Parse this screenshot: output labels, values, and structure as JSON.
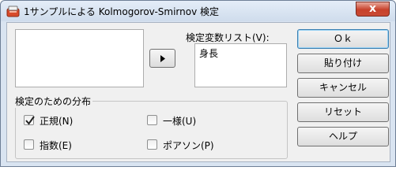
{
  "window": {
    "title": "1サンプルによる Kolmogorov-Smirnov 検定",
    "close_glyph": "x"
  },
  "source_list": {
    "items": []
  },
  "move_button": {
    "icon": "triangle-right-icon"
  },
  "test_variables": {
    "label": "検定変数リスト(V):",
    "items": [
      "身長"
    ]
  },
  "distribution_group": {
    "label": "検定のための分布",
    "options": {
      "normal": {
        "label": "正規(N)",
        "checked": true
      },
      "uniform": {
        "label": "一様(U)",
        "checked": false
      },
      "exponential": {
        "label": "指数(E)",
        "checked": false
      },
      "poisson": {
        "label": "ポアソン(P)",
        "checked": false
      }
    }
  },
  "buttons": {
    "ok": "Ｏｋ",
    "paste": "貼り付け",
    "cancel": "キャンセル",
    "reset": "リセット",
    "help": "ヘルプ"
  },
  "colors": {
    "titlebar": "#d9e4f1",
    "close_button": "#c7412b",
    "dialog_face": "#f0f0f0"
  }
}
